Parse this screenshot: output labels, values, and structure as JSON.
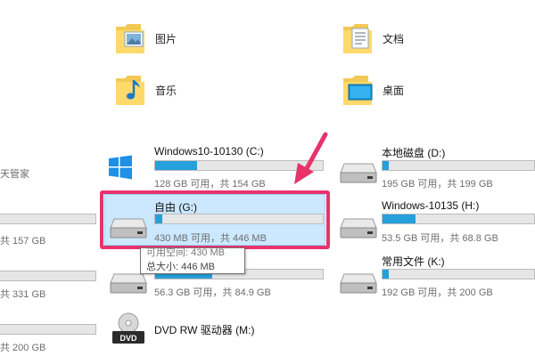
{
  "folders": [
    {
      "label": "图片",
      "icon": "pictures-folder-icon"
    },
    {
      "label": "文档",
      "icon": "documents-folder-icon"
    },
    {
      "label": "音乐",
      "icon": "music-folder-icon"
    },
    {
      "label": "桌面",
      "icon": "desktop-folder-icon"
    }
  ],
  "left_partial": {
    "label": "天管家",
    "sizes": [
      "共 157 GB",
      "共 331 GB",
      "共 200 GB"
    ]
  },
  "drives": [
    {
      "name": "Windows10-10130 (C:)",
      "info": "128 GB 可用，共 154 GB",
      "used_fraction": 0.25,
      "icon": "windows-drive-icon"
    },
    {
      "name": "本地磁盘 (D:)",
      "info": "195 GB 可用，共 199 GB",
      "used_fraction": 0.04,
      "icon": "hard-drive-icon"
    },
    {
      "name": "自由 (G:)",
      "info": "430 MB 可用，共 446 MB",
      "used_fraction": 0.04,
      "icon": "hard-drive-icon"
    },
    {
      "name": "Windows-10135 (H:)",
      "info": "53.5 GB 可用，共 68.8 GB",
      "used_fraction": 0.22,
      "icon": "hard-drive-icon"
    },
    {
      "name": "",
      "info": "56.3 GB 可用，共 84.9 GB",
      "used_fraction": 0.34,
      "icon": "hard-drive-icon"
    },
    {
      "name": "常用文件 (K:)",
      "info": "192 GB 可用，共 200 GB",
      "used_fraction": 0.04,
      "icon": "hard-drive-icon"
    },
    {
      "name": "DVD RW 驱动器 (M:)",
      "info": "",
      "icon": "dvd-drive-icon"
    }
  ],
  "tooltip": {
    "line1": "可用空间: 430 MB",
    "line2": "总大小: 446 MB"
  },
  "colors": {
    "usage_bar": "#26a0da",
    "selection": "#cce8ff",
    "annotation": "#e8336b"
  }
}
